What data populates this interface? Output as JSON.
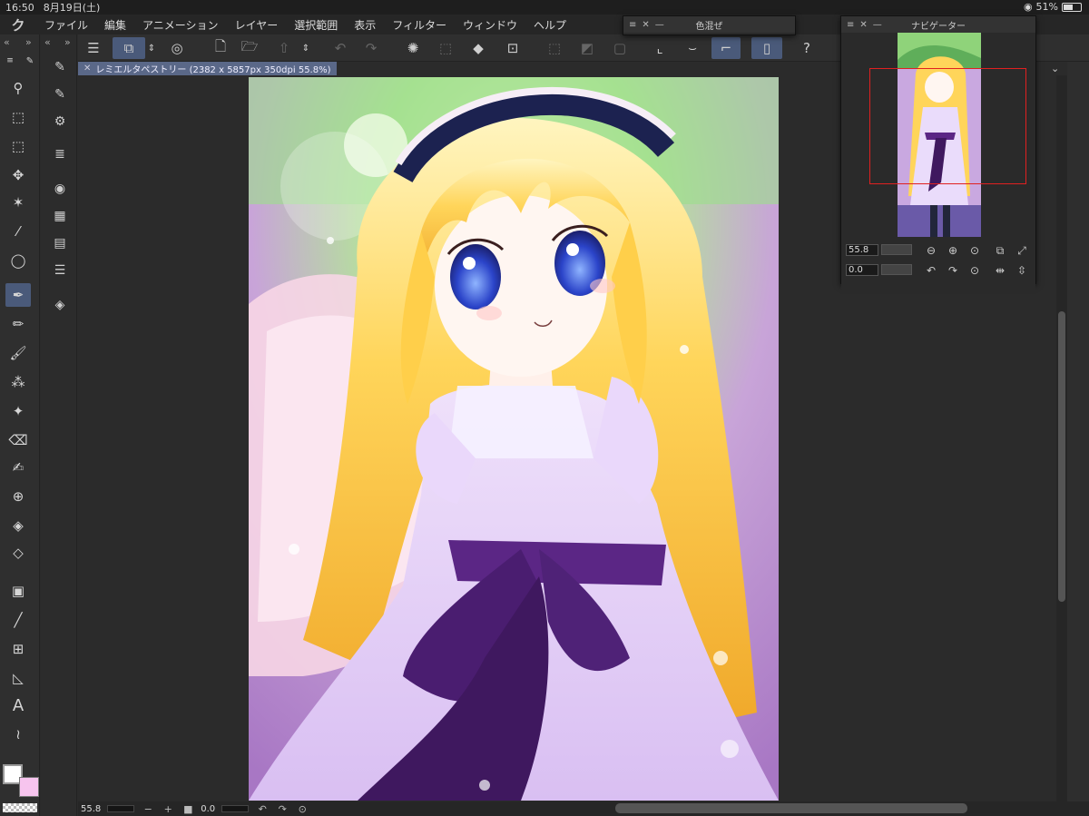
{
  "status_bar": {
    "time": "16:50",
    "date": "8月19日(土)",
    "battery": "51%",
    "battery_level": 0.51
  },
  "menu": {
    "items": [
      "ファイル",
      "編集",
      "アニメーション",
      "レイヤー",
      "選択範囲",
      "表示",
      "フィルター",
      "ウィンドウ",
      "ヘルプ"
    ]
  },
  "document": {
    "tab_label": "レミエルタペストリー (2382 x 5857px 350dpi 55.8%)"
  },
  "color_panel": {
    "title": "色混ぜ"
  },
  "navigator": {
    "title": "ナビゲーター",
    "zoom_value": "55.8",
    "rotate_value": "0.0"
  },
  "bottom_bar": {
    "zoom_value": "55.8",
    "rotate_value": "0.0",
    "minus": "−",
    "plus": "+"
  },
  "colors": {
    "main_color": "#ffffff",
    "sub_color": "#f7c4ee",
    "accent_active": "#4a5a7a",
    "viewport_frame": "#e02020"
  },
  "tools": [
    "zoom-icon",
    "operation-icon",
    "move-layer-icon",
    "move-icon",
    "auto-select-icon",
    "eyedropper-icon",
    "lasso-icon",
    "pen-icon",
    "pencil-icon",
    "brush-icon",
    "airbrush-icon",
    "decoration-icon",
    "eraser-icon",
    "blend-icon",
    "figure-icon",
    "fill-icon",
    "fill-eraser-icon",
    "gradient-icon",
    "line-icon",
    "frame-icon",
    "ruler-icon",
    "text-icon",
    "balloon-icon"
  ],
  "artwork": {
    "description_hidden": ""
  }
}
